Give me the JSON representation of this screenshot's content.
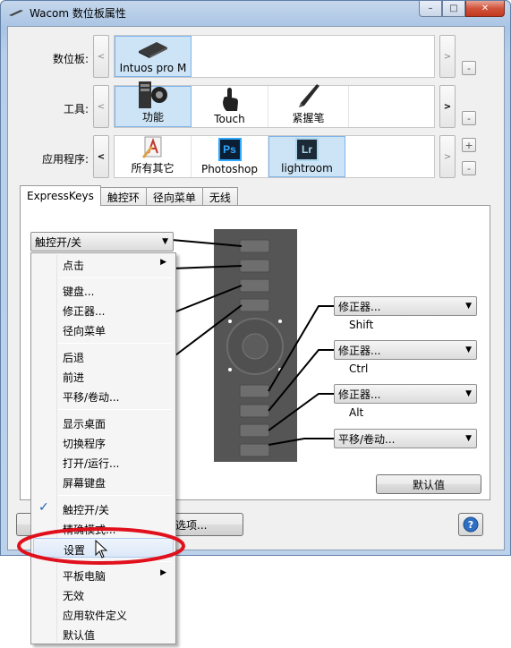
{
  "window": {
    "title": "Wacom 数位板属性",
    "min_label": "–",
    "max_label": "□",
    "close_label": "✕"
  },
  "tablet": {
    "label": "数位板:",
    "items": [
      {
        "label": "Intuos pro M",
        "icon": "tablet-icon"
      }
    ]
  },
  "tools": {
    "label": "工具:",
    "items": [
      {
        "label": "功能",
        "icon": "functions-icon"
      },
      {
        "label": "Touch",
        "icon": "touch-hand-icon"
      },
      {
        "label": "紧握笔",
        "icon": "grip-pen-icon"
      }
    ]
  },
  "apps": {
    "label": "应用程序:",
    "items": [
      {
        "label": "所有其它",
        "icon": "all-other-apps-icon"
      },
      {
        "label": "Photoshop",
        "icon": "photoshop-icon",
        "badge": "Ps",
        "color": "#31a8ff"
      },
      {
        "label": "lightroom",
        "icon": "lightroom-icon",
        "badge": "Lr",
        "color": "#add5ec"
      }
    ]
  },
  "controls": {
    "left": "<",
    "right": ">",
    "plus": "+",
    "minus": "-"
  },
  "tabs": [
    {
      "label": "ExpressKeys"
    },
    {
      "label": "触控环"
    },
    {
      "label": "径向菜单"
    },
    {
      "label": "无线"
    }
  ],
  "expresskeys": {
    "top_combo": "触控开/关",
    "right_combos": [
      {
        "value": "修正器...",
        "caption": "Shift"
      },
      {
        "value": "修正器...",
        "caption": "Ctrl"
      },
      {
        "value": "修正器...",
        "caption": "Alt"
      },
      {
        "value": "平移/卷动...",
        "caption": ""
      }
    ],
    "default_button": "默认值"
  },
  "bottom": {
    "options_button": "选项...",
    "help_icon": "help-icon"
  },
  "menu": {
    "items": [
      {
        "label": "点击",
        "submenu": true
      },
      {
        "label": "键盘..."
      },
      {
        "label": "修正器..."
      },
      {
        "label": "径向菜单"
      },
      {
        "label": "后退"
      },
      {
        "label": "前进"
      },
      {
        "label": "平移/卷动..."
      },
      {
        "label": "显示桌面"
      },
      {
        "label": "切换程序"
      },
      {
        "label": "打开/运行..."
      },
      {
        "label": "屏幕键盘"
      },
      {
        "label": "触控开/关",
        "checked": true
      },
      {
        "label": "精确模式..."
      },
      {
        "label": "设置",
        "hover": true
      },
      {
        "label": "平板电脑",
        "submenu": true
      },
      {
        "label": "无效"
      },
      {
        "label": "应用软件定义"
      },
      {
        "label": "默认值"
      }
    ]
  },
  "annotation_color": "#e0101c"
}
